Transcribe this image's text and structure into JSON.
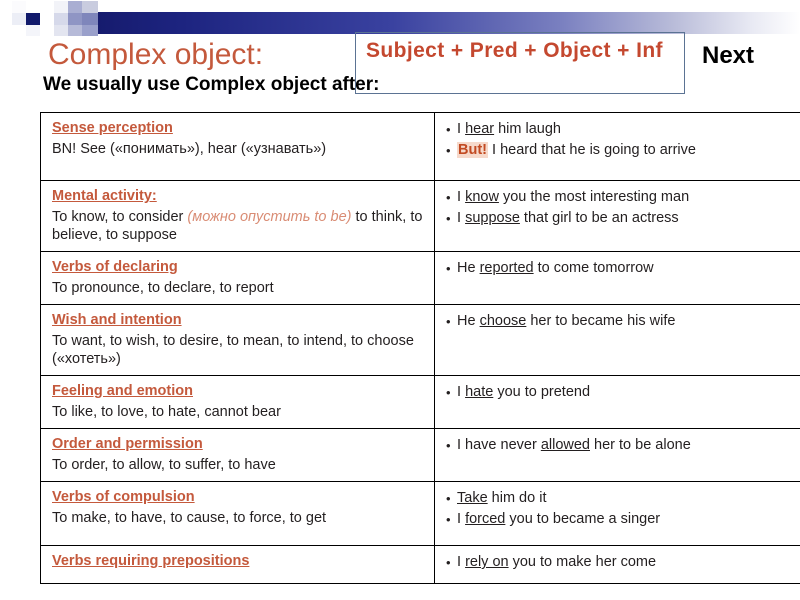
{
  "header": {
    "title": "Complex object:",
    "subtitle": "We usually use Complex object after:",
    "formula": "Subject + Pred + Object + Inf",
    "next_label": "Next",
    "accent_color": "#c4593c",
    "formula_color": "#c4482f",
    "band_color": "#161b6e"
  },
  "table": {
    "rows": [
      {
        "category": "Sense perception",
        "verbs_prefix": "BN! See («понимать»), hear («узнавать»)",
        "verbs_note": "",
        "verbs_suffix": "",
        "examples": [
          {
            "pre": "I ",
            "underline": "hear",
            "post": " him  laugh",
            "badge": ""
          },
          {
            "pre": "",
            "underline": "",
            "post": " I heard that he is going to arrive",
            "badge": "But!"
          }
        ]
      },
      {
        "category": "Mental activity:",
        "verbs_prefix": "To know,  to consider ",
        "verbs_note": "(можно опустить to be)",
        "verbs_suffix": " to think, to believe, to suppose",
        "examples": [
          {
            "pre": "I ",
            "underline": "know",
            "post": " you the most interesting man",
            "badge": ""
          },
          {
            "pre": "I ",
            "underline": "suppose",
            "post": " that girl to be an actress",
            "badge": ""
          }
        ]
      },
      {
        "category": "Verbs of declaring",
        "verbs_prefix": "To pronounce, to declare, to report",
        "verbs_note": "",
        "verbs_suffix": "",
        "examples": [
          {
            "pre": "He ",
            "underline": "reported",
            "post": " to come tomorrow",
            "badge": ""
          }
        ]
      },
      {
        "category": "Wish and intention",
        "verbs_prefix": "To want, to wish, to desire, to mean, to intend, to choose («хотеть»)",
        "verbs_note": "",
        "verbs_suffix": "",
        "examples": [
          {
            "pre": "He ",
            "underline": "choose",
            "post": " her to became his wife",
            "badge": ""
          }
        ]
      },
      {
        "category": "Feeling and emotion",
        "verbs_prefix": "To like, to love, to hate, cannot bear",
        "verbs_note": "",
        "verbs_suffix": "",
        "examples": [
          {
            "pre": "I ",
            "underline": "hate",
            "post": " you to pretend",
            "badge": ""
          }
        ]
      },
      {
        "category": "Order and permission",
        "verbs_prefix": "To order, to allow, to suffer, to have",
        "verbs_note": "",
        "verbs_suffix": "",
        "examples": [
          {
            "pre": "I have never ",
            "underline": "allowed",
            "post": " her to be alone",
            "badge": ""
          }
        ]
      },
      {
        "category": "Verbs of compulsion",
        "verbs_prefix": "To make, to have, to cause, to force, to get",
        "verbs_note": "",
        "verbs_suffix": "",
        "examples": [
          {
            "pre": "",
            "underline": "Take",
            "post": " him do it",
            "badge": ""
          },
          {
            "pre": "I ",
            "underline": "forced",
            "post": " you to became a singer",
            "badge": ""
          }
        ]
      },
      {
        "category": "Verbs requiring prepositions ",
        "verbs_prefix": "",
        "verbs_note": "",
        "verbs_suffix": "",
        "examples": [
          {
            "pre": "I ",
            "underline": "rely on",
            "post": " you to make her come",
            "badge": ""
          }
        ]
      }
    ]
  }
}
